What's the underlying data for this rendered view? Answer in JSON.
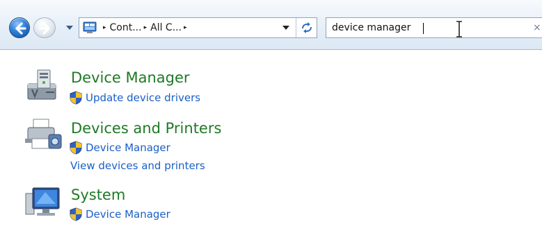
{
  "address_bar": {
    "crumbs": [
      "Cont...",
      "All C..."
    ],
    "separator": "▸"
  },
  "search": {
    "value": "device manager",
    "clear_glyph": "×"
  },
  "results": [
    {
      "title": "Device Manager",
      "icon": "device-manager-icon",
      "tasks": [
        {
          "label": "Update device drivers",
          "shield": true
        }
      ]
    },
    {
      "title": "Devices and Printers",
      "icon": "printer-icon",
      "tasks": [
        {
          "label": "Device Manager",
          "shield": true
        },
        {
          "label": "View devices and printers",
          "shield": false
        }
      ]
    },
    {
      "title": "System",
      "icon": "system-monitor-icon",
      "tasks": [
        {
          "label": "Device Manager",
          "shield": true
        }
      ]
    }
  ],
  "colors": {
    "title_green": "#1e7a25",
    "link_blue": "#1a5fc7",
    "navbar_border": "#a6b9cf"
  }
}
